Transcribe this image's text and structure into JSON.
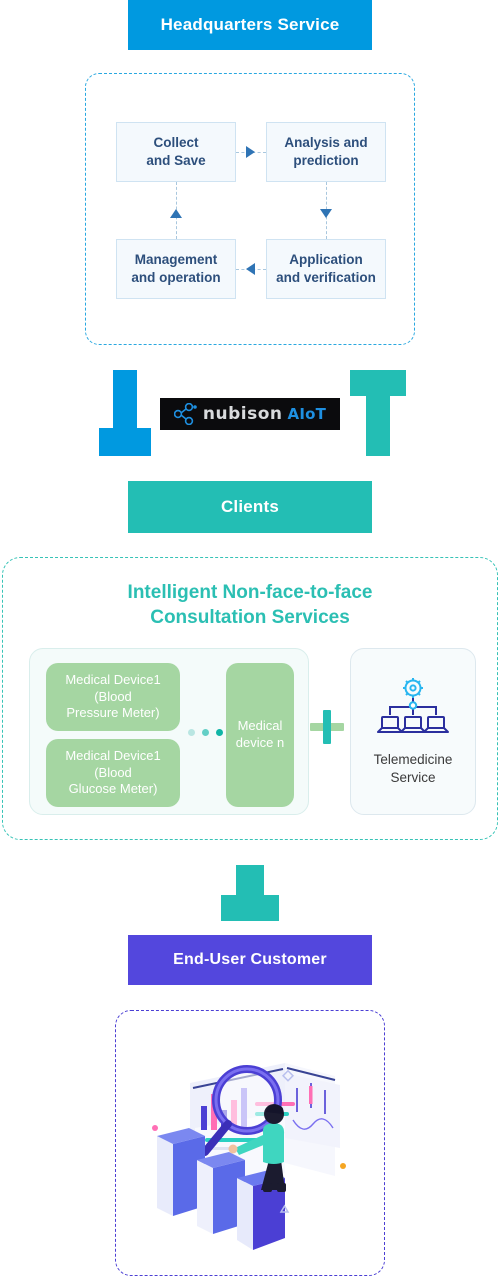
{
  "headquarters": {
    "title": "Headquarters Service",
    "color": "#0099e0",
    "cycle": {
      "boxes": [
        {
          "id": "collect",
          "label": "Collect\nand Save"
        },
        {
          "id": "analysis",
          "label": "Analysis and\nprediction"
        },
        {
          "id": "manage",
          "label": "Management\nand operation"
        },
        {
          "id": "apply",
          "label": "Application\nand verification"
        }
      ],
      "box_fill": "#f4f9fd",
      "box_border": "#cfe3f2",
      "text_color": "#2d4f7c",
      "panel_border": "#29a8e0",
      "arrow_color": "#2f74b5",
      "flow_order": "collect -> analysis -> apply -> manage -> collect"
    }
  },
  "logo": {
    "wordmark": "nubison",
    "suffix": "AIoT",
    "background": "#0b0b0d",
    "wordmark_color": "#d9dbdd",
    "suffix_color": "#1e8fe0",
    "arrow_down_color": "#0099e0",
    "arrow_up_color": "#23beb4"
  },
  "clients": {
    "title": "Clients",
    "color": "#23beb4"
  },
  "consultation": {
    "title": "Intelligent Non-face-to-face\nConsultation Services",
    "title_color": "#2bbfb3",
    "panel_border": "#36c3b6",
    "devices": [
      {
        "label": "Medical Device1\n(Blood\nPressure Meter)"
      },
      {
        "label": "Medical Device1\n(Blood\nGlucose Meter)"
      }
    ],
    "device_n": {
      "label": "Medical device n"
    },
    "device_fill": "#a5d6a2",
    "dots": [
      "#b9e6e2",
      "#63cfc6",
      "#11b5a6"
    ],
    "plus": {
      "horizontal_color": "#a5d6a2",
      "vertical_color": "#23beb4"
    },
    "telemedicine": {
      "label": "Telemedicine\nService",
      "icon": "gear-laptops-network-icon",
      "icon_colors": {
        "gear": "#29b6f0",
        "laptops": "#2b2f9e"
      }
    }
  },
  "end_user": {
    "title": "End-User Customer",
    "color": "#5347dd",
    "arrow_color": "#23beb4"
  },
  "illustration": {
    "name": "data-analysis-magnifier-illustration",
    "panel_border": "#4b3fd4",
    "description": "Person standing on isometric bar charts holding a magnifying glass over dashboard panels"
  }
}
